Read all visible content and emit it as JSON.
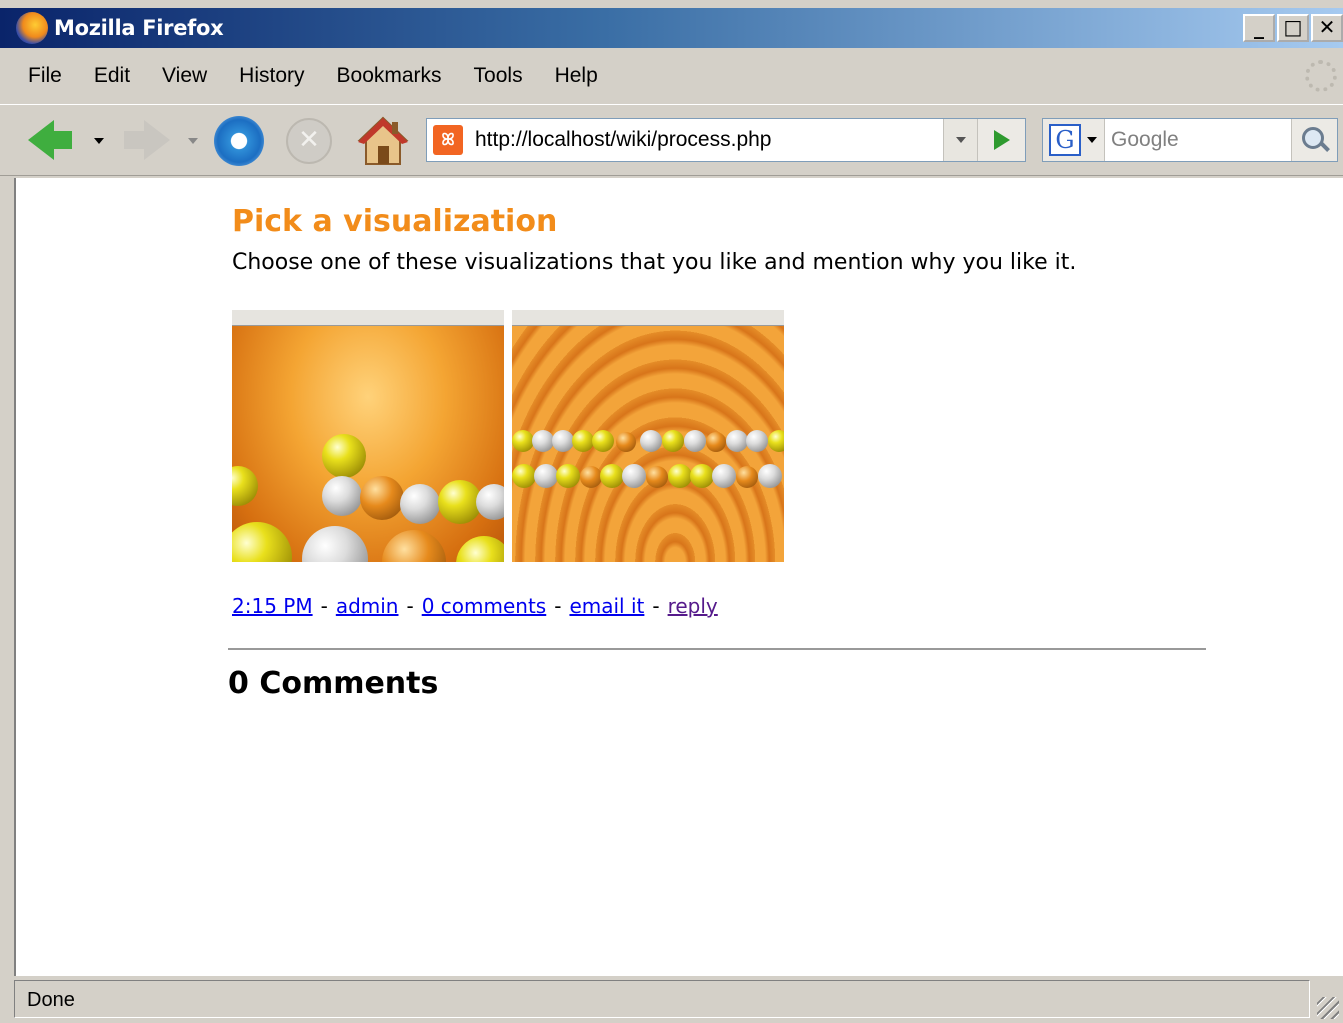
{
  "window": {
    "title": "Mozilla Firefox",
    "controls": [
      "minimize",
      "maximize",
      "close"
    ]
  },
  "menu": {
    "items": [
      {
        "label": "File"
      },
      {
        "label": "Edit"
      },
      {
        "label": "View"
      },
      {
        "label": "History"
      },
      {
        "label": "Bookmarks"
      },
      {
        "label": "Tools"
      },
      {
        "label": "Help"
      }
    ]
  },
  "toolbar": {
    "url": "http://localhost/wiki/process.php",
    "search_placeholder": "Google",
    "search_engine_letter": "G",
    "stop_glyph": "✕"
  },
  "page": {
    "title": "Pick a visualization",
    "description": "Choose one of these visualizations that you like and mention why you like it.",
    "meta": {
      "time": "2:15 PM",
      "author": "admin",
      "comments_link": "0 comments",
      "email": "email it",
      "reply": "reply",
      "separator": "-"
    },
    "comments_heading": "0 Comments"
  },
  "status": {
    "text": "Done"
  },
  "colors": {
    "heading": "#f28c1a",
    "link": "#0000ee",
    "visited_link": "#551a8b",
    "titlebar_start": "#0a246a",
    "titlebar_end": "#a6caf0"
  }
}
